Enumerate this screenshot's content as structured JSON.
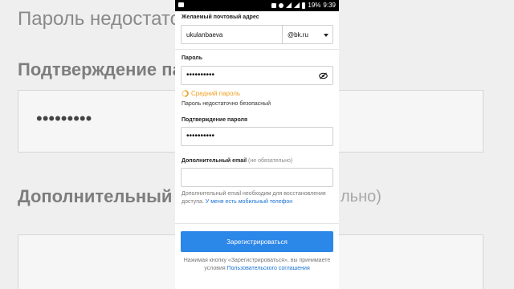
{
  "background": {
    "line1": "Пароль недостато",
    "line2": "Подтверждение па",
    "line3": "Дополнительный",
    "right_fragment": "льно)",
    "dots": "•••••••••"
  },
  "status_bar": {
    "battery": "19%",
    "time": "9:39"
  },
  "form": {
    "email_label": "Желаемый почтовый адрес",
    "email_value": "ukulanbaeva",
    "domain_value": "@bk.ru",
    "password_label": "Пароль",
    "password_mask": "••••••••••",
    "strength_label": "Средний пароль",
    "strength_hint": "Пароль недостаточно безопасный",
    "confirm_label": "Подтверждение пароля",
    "confirm_mask": "••••••••••",
    "extra_email_label": "Дополнительный email",
    "extra_email_optional": "(не обязательно)",
    "extra_email_help": "Дополнительный email необходим для восстановления доступа.",
    "extra_email_link": "У меня есть мобильный телефон",
    "register_button": "Зарегистрироваться",
    "terms_text": "Нажимая кнопку «Зарегистрироваться», вы принимаете условия",
    "terms_link": "Пользовательского соглашения"
  },
  "colors": {
    "accent": "#2b87e8",
    "warning": "#f0a020",
    "link": "#1a72d4"
  }
}
